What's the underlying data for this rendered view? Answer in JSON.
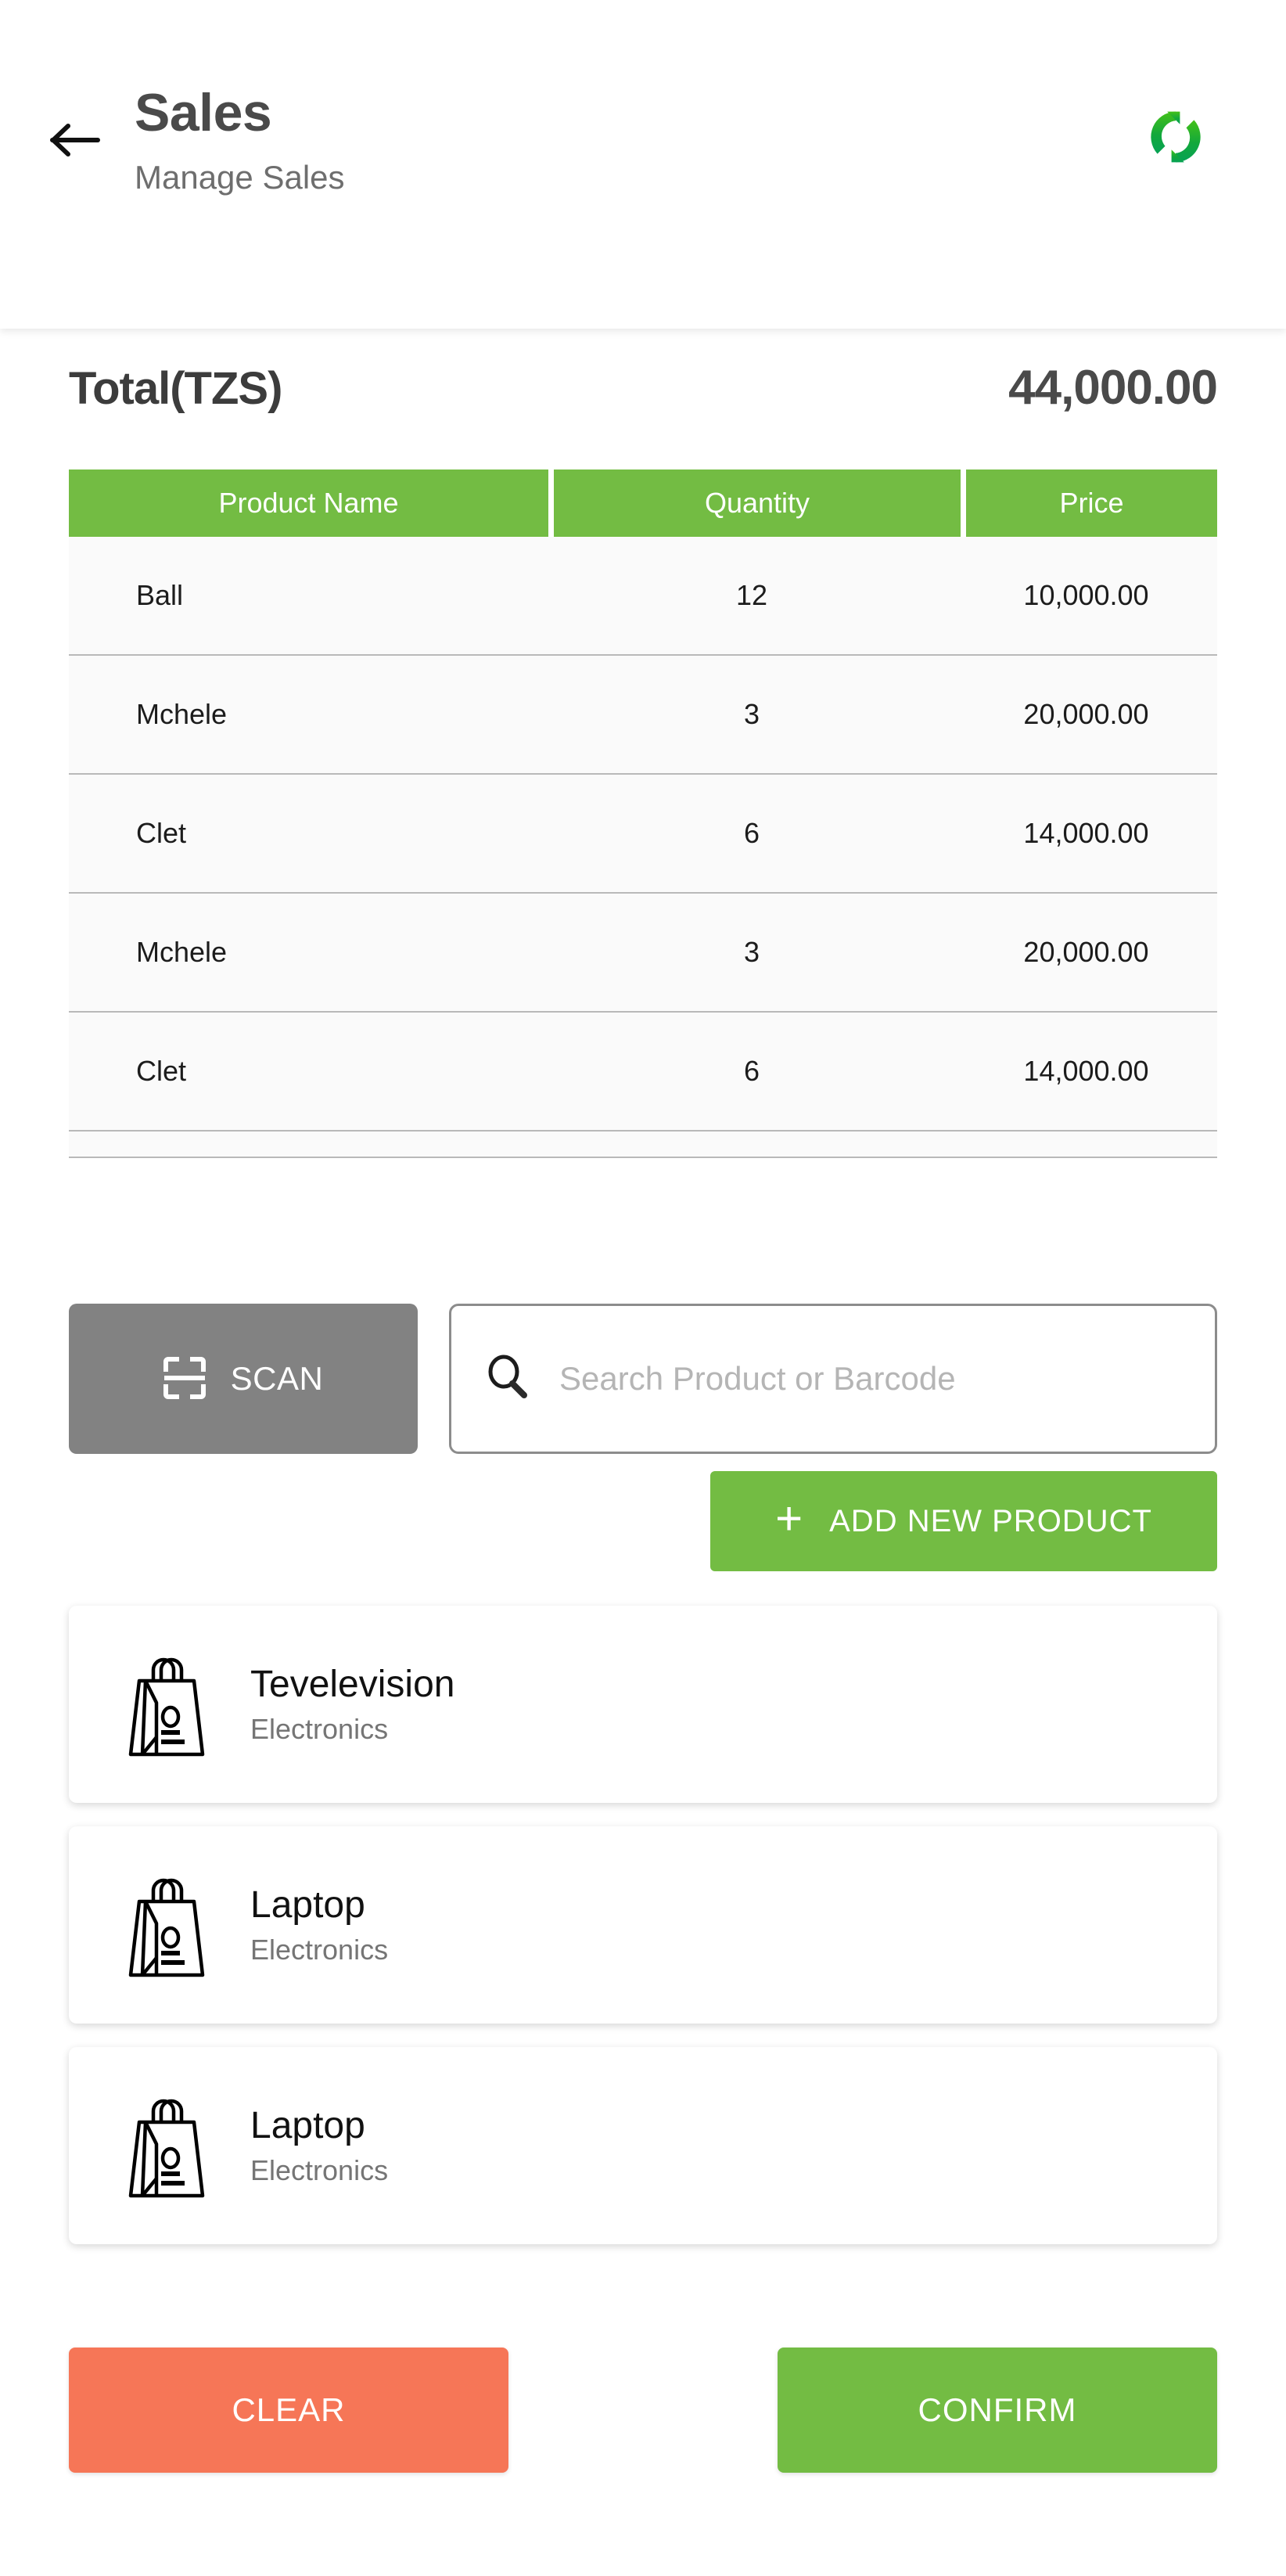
{
  "header": {
    "title": "Sales",
    "subtitle": "Manage Sales",
    "back_icon": "arrow-left-icon",
    "sync_icon": "sync-refresh-icon"
  },
  "summary": {
    "total_label": "Total(TZS)",
    "total_value": "44,000.00"
  },
  "cart_table": {
    "columns": [
      "Product Name",
      "Quantity",
      "Price"
    ],
    "rows": [
      {
        "name": "Ball",
        "quantity": "12",
        "price": "10,000.00"
      },
      {
        "name": "Mchele",
        "quantity": "3",
        "price": "20,000.00"
      },
      {
        "name": "Clet",
        "quantity": "6",
        "price": "14,000.00"
      },
      {
        "name": "Mchele",
        "quantity": "3",
        "price": "20,000.00"
      },
      {
        "name": "Clet",
        "quantity": "6",
        "price": "14,000.00"
      }
    ]
  },
  "toolbar": {
    "scan_label": "SCAN",
    "scan_icon": "barcode-scan-icon",
    "search_icon": "search-icon",
    "search_value": "",
    "search_placeholder": "Search Product or Barcode",
    "add_product_label": "ADD NEW PRODUCT",
    "add_product_icon": "plus-icon"
  },
  "results": {
    "items": [
      {
        "name": "Tevelevision",
        "category": "Electronics",
        "icon": "shopping-bag-icon"
      },
      {
        "name": "Laptop",
        "category": "Electronics",
        "icon": "shopping-bag-icon"
      },
      {
        "name": "Laptop",
        "category": "Electronics",
        "icon": "shopping-bag-icon"
      }
    ]
  },
  "footer": {
    "clear_label": "CLEAR",
    "confirm_label": "CONFIRM"
  },
  "colors": {
    "green": "#73BC43",
    "coral": "#F67657",
    "scan_gray": "#828282",
    "sync_green_light": "#3FBF1E",
    "sync_green_dark": "#0FA04A"
  }
}
